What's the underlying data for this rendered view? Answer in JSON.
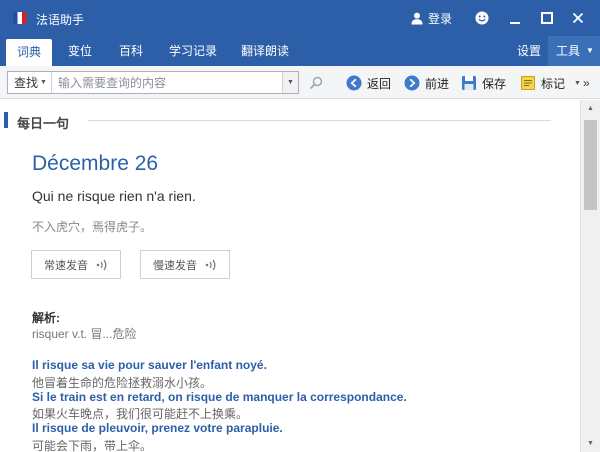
{
  "window": {
    "title": "法语助手",
    "login": "登录"
  },
  "tabs": [
    {
      "label": "词典",
      "active": true
    },
    {
      "label": "变位"
    },
    {
      "label": "百科"
    },
    {
      "label": "学习记录"
    },
    {
      "label": "翻译朗读"
    }
  ],
  "settings_label": "设置",
  "tools_label": "工具",
  "search": {
    "type_label": "查找",
    "placeholder": "输入需要查询的内容"
  },
  "toolbar": {
    "back": "返回",
    "forward": "前进",
    "save": "保存",
    "bookmark": "标记"
  },
  "daily": {
    "section_title": "每日一句",
    "date": "Décembre 26",
    "phrase": "Qui ne risque rien n'a rien.",
    "translation": "不入虎穴，焉得虎子。",
    "normal_audio": "常速发音",
    "slow_audio": "慢速发音",
    "analysis_label": "解析:",
    "analysis": "risquer v.t. 冒...危险",
    "examples": [
      {
        "fr": "Il risque sa vie pour sauver l'enfant noyé.",
        "cn": "他冒着生命的危险拯救溺水小孩。"
      },
      {
        "fr": "Si le train est en retard, on risque de manquer la correspondance.",
        "cn": "如果火车晚点，我们很可能赶不上换乘。"
      },
      {
        "fr": "Il risque de pleuvoir, prenez votre parapluie.",
        "cn": "可能会下雨，带上伞。"
      }
    ]
  },
  "colors": {
    "brand": "#2c5fa8",
    "toolbar_bg": "#f4f5f7"
  }
}
